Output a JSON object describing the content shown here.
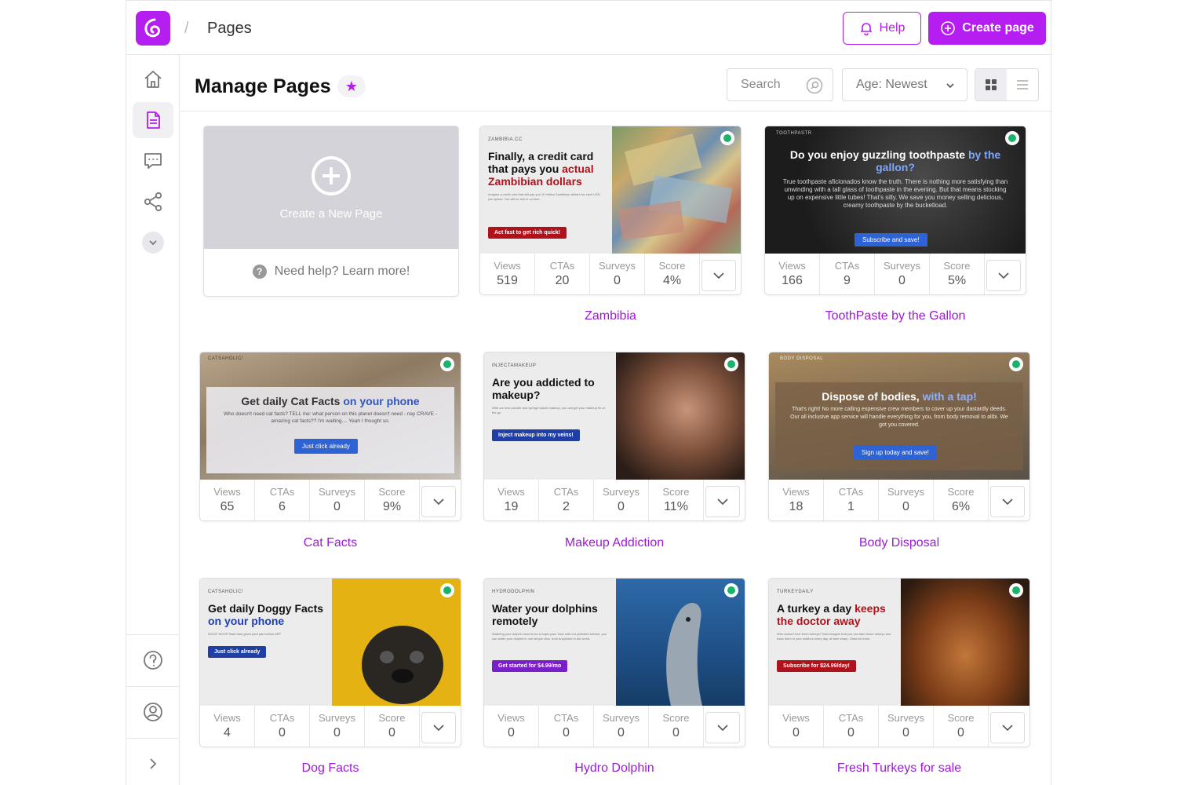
{
  "topbar": {
    "breadcrumb": "Pages",
    "help_label": "Help",
    "create_label": "Create page"
  },
  "header": {
    "title": "Manage Pages",
    "search_placeholder": "Search",
    "sort_value": "Age: Newest"
  },
  "new_card": {
    "label": "Create a New Page",
    "help_text": "Need help? Learn more!"
  },
  "stat_labels": {
    "views": "Views",
    "ctas": "CTAs",
    "surveys": "Surveys",
    "score": "Score"
  },
  "colors": {
    "brand": "#b51ef0",
    "active_dot": "#19b36b",
    "title_link": "#9c1bd6"
  },
  "cards": [
    {
      "title": "Zambibia",
      "views": "519",
      "ctas": "20",
      "surveys": "0",
      "score": "4%",
      "thumb": {
        "brand": "ZAMBIBIA.CC",
        "headline_a": "Finally, a credit card that pays you ",
        "headline_b": "actual Zambibian dollars",
        "button": "Act fast to get rich quick!"
      }
    },
    {
      "title": "ToothPaste by the Gallon",
      "views": "166",
      "ctas": "9",
      "surveys": "0",
      "score": "5%",
      "thumb": {
        "brand": "TOOTHPASTR",
        "headline_a": "Do you enjoy guzzling toothpaste ",
        "headline_b": "by the gallon?",
        "body": "True toothpaste aficionados know the truth. There is nothing more satisfying than unwinding with a tall glass of toothpaste in the evening. But that means stocking up on expensive little tubes! That's silly. We save you money selling delicious, creamy toothpaste by the bucketload.",
        "button": "Subscribe and save!"
      }
    },
    {
      "title": "Cat Facts",
      "views": "65",
      "ctas": "6",
      "surveys": "0",
      "score": "9%",
      "thumb": {
        "brand": "CATSAHOLIC!",
        "headline_a": "Get daily Cat Facts ",
        "headline_b": "on your phone",
        "body": "Who doesn't need cat facts? TELL me: what person on this planet doesn't need - nay CRAVE - amazing cat facts?? I'm waiting.... Yeah I thought so.",
        "button": "Just click already"
      }
    },
    {
      "title": "Makeup Addiction",
      "views": "19",
      "ctas": "2",
      "surveys": "0",
      "score": "11%",
      "thumb": {
        "brand": "INJECTAMAKEUP",
        "headline_a": "Are you addicted to makeup?",
        "headline_b": "",
        "button": "Inject makeup into my veins!"
      }
    },
    {
      "title": "Body Disposal",
      "views": "18",
      "ctas": "1",
      "surveys": "0",
      "score": "6%",
      "thumb": {
        "brand": "BODY DISPOSAL",
        "headline_a": "Dispose of bodies, ",
        "headline_b": "with a tap!",
        "body": "That's right! No more calling expensive crew members to cover up your dastardly deeds. Our all inclusive app service will handle everything for you, from body removal to alibi. We got you covered.",
        "button": "Sign up today and save!"
      }
    },
    {
      "title": "Dog Facts",
      "views": "4",
      "ctas": "0",
      "surveys": "0",
      "score": "0",
      "thumb": {
        "brand": "CATSAHOLIC!",
        "headline_a": "Get daily Doggy Facts ",
        "headline_b": "on your phone",
        "button": "Just click already"
      }
    },
    {
      "title": "Hydro Dolphin",
      "views": "0",
      "ctas": "0",
      "surveys": "0",
      "score": "0",
      "thumb": {
        "brand": "HYDRODOLPHIN",
        "headline_a": "Water your dolphins remotely",
        "headline_b": "",
        "button": "Get started for $4.99/mo"
      }
    },
    {
      "title": "Fresh Turkeys for sale",
      "views": "0",
      "ctas": "0",
      "surveys": "0",
      "score": "0",
      "thumb": {
        "brand": "TURKEYDAILY",
        "headline_a": "A turkey a day ",
        "headline_b": "keeps the doctor away",
        "button": "Subscribe for $24.99/day!"
      }
    }
  ]
}
